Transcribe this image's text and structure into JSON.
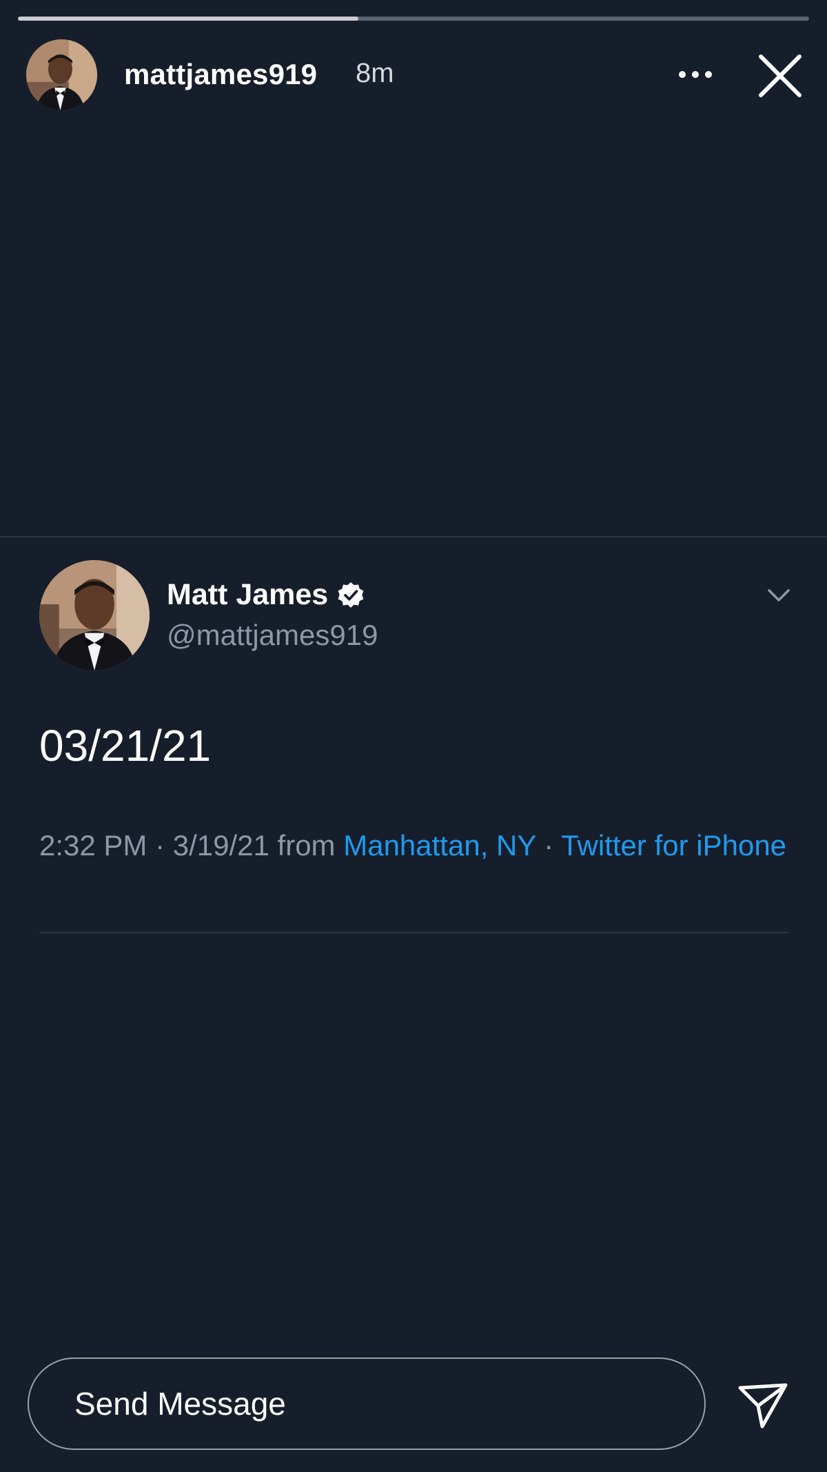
{
  "story": {
    "progress": 0.43,
    "username": "mattjames919",
    "time_ago": "8m",
    "avatar_icon": "profile-photo-icon",
    "more_icon": "more-horizontal-icon",
    "close_icon": "close-icon"
  },
  "tweet": {
    "display_name": "Matt James",
    "verified_icon": "verified-badge-icon",
    "handle": "@mattjames919",
    "chevron_icon": "chevron-down-icon",
    "text": "03/21/21",
    "timestamp": "2:32 PM · 3/19/21",
    "from_label": "from",
    "location": "Manhattan, NY",
    "separator": "·",
    "source": "Twitter for iPhone"
  },
  "reply": {
    "placeholder": "Send Message",
    "send_icon": "send-icon"
  },
  "colors": {
    "background": "#161e2b",
    "link": "#1d9bf0",
    "muted_text": "#8b98a5",
    "progress_fill": "#c9ccd1",
    "progress_track": "#5b6270"
  }
}
